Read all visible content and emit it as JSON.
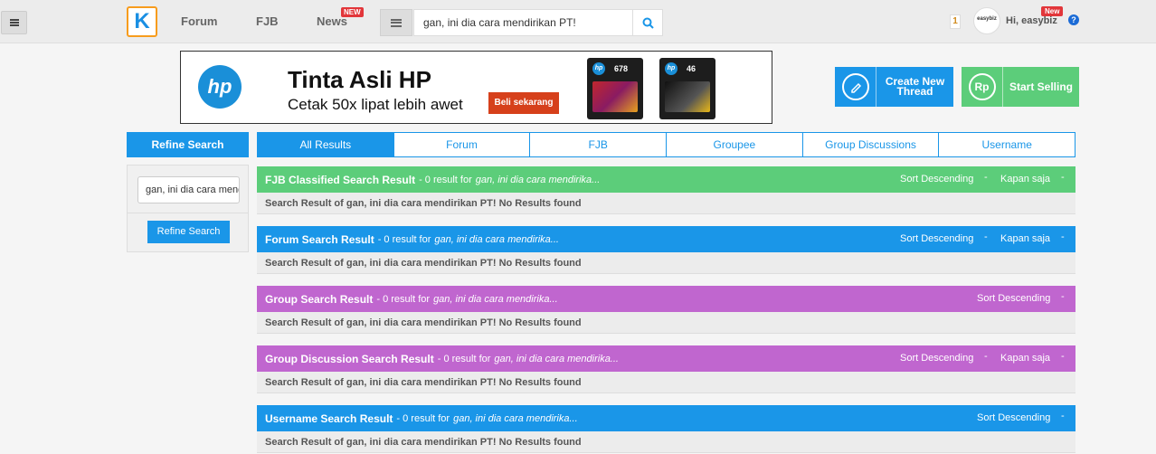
{
  "header": {
    "logo_letter": "K",
    "nav": [
      {
        "label": "Forum"
      },
      {
        "label": "FJB"
      },
      {
        "label": "News",
        "badge": "NEW"
      }
    ],
    "search_value": "gan, ini dia cara mendirikan PT!",
    "notification_count": "1",
    "avatar_text": "easybiz",
    "avatar_badge": "New",
    "greeting": "Hi, easybiz",
    "help_glyph": "?"
  },
  "banner": {
    "logo": "hp",
    "title": "Tinta Asli HP",
    "subtitle": "Cetak 50x lipat lebih awet",
    "cta": "Beli sekarang",
    "cartridge_1": "678",
    "cartridge_2": "46"
  },
  "actions": {
    "create_thread": "Create New Thread",
    "start_selling": "Start Selling",
    "sell_icon": "Rp"
  },
  "sidebar": {
    "header": "Refine Search",
    "input_value": "gan, ini dia cara mendirikan PT!",
    "button": "Refine Search"
  },
  "tabs": [
    "All Results",
    "Forum",
    "FJB",
    "Groupee",
    "Group Discussions",
    "Username"
  ],
  "results": [
    {
      "title": "FJB Classified Search Result",
      "meta": "- 0 result for",
      "query": "gan, ini dia cara mendirika...",
      "sort": "Sort Descending",
      "time": "Kapan saja",
      "color": "#5ccd7a",
      "body": "Search Result of gan, ini dia cara mendirikan PT! No Results found"
    },
    {
      "title": "Forum Search Result",
      "meta": "- 0 result for",
      "query": "gan, ini dia cara mendirika...",
      "sort": "Sort Descending",
      "time": "Kapan saja",
      "color": "#1a96e8",
      "body": "Search Result of gan, ini dia cara mendirikan PT! No Results found"
    },
    {
      "title": "Group Search Result",
      "meta": "- 0 result for",
      "query": "gan, ini dia cara mendirika...",
      "sort": "Sort Descending",
      "time": "",
      "color": "#c066cf",
      "body": "Search Result of gan, ini dia cara mendirikan PT! No Results found"
    },
    {
      "title": "Group Discussion Search Result",
      "meta": "- 0 result for",
      "query": "gan, ini dia cara mendirika...",
      "sort": "Sort Descending",
      "time": "Kapan saja",
      "color": "#c066cf",
      "body": "Search Result of gan, ini dia cara mendirikan PT! No Results found"
    },
    {
      "title": "Username Search Result",
      "meta": "- 0 result for",
      "query": "gan, ini dia cara mendirika...",
      "sort": "Sort Descending",
      "time": "",
      "color": "#1a96e8",
      "body": "Search Result of gan, ini dia cara mendirikan PT! No Results found"
    }
  ],
  "caret_glyph": "-"
}
